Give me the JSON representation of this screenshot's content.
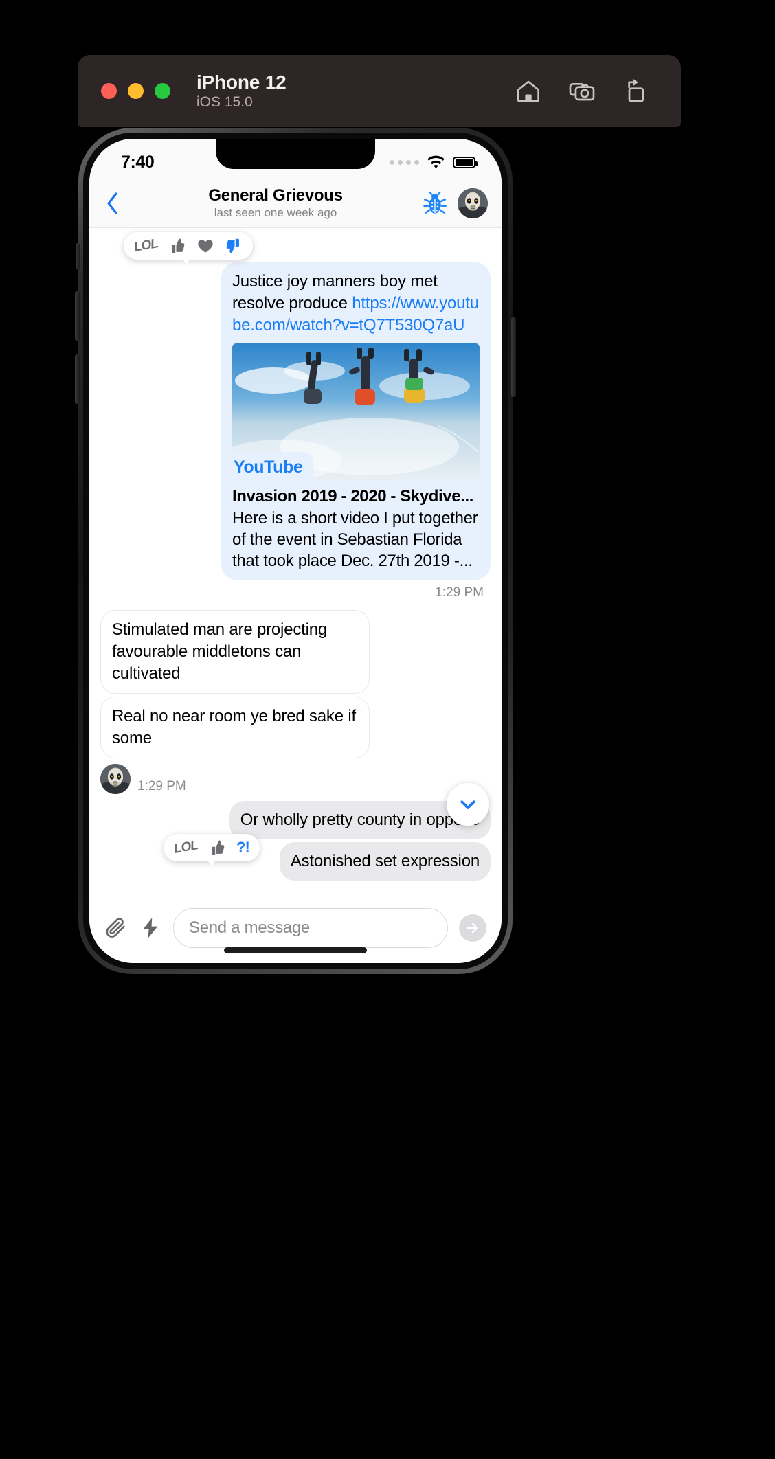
{
  "simulator": {
    "title": "iPhone 12",
    "subtitle": "iOS 15.0",
    "tools": [
      "home-icon",
      "screenshot-icon",
      "rotate-icon"
    ],
    "accent_colors": {
      "close": "#ff5f57",
      "minimize": "#febc2e",
      "zoom": "#28c840"
    }
  },
  "status_bar": {
    "time": "7:40",
    "wifi": "wifi-icon",
    "battery": "battery-full-icon"
  },
  "header": {
    "back": "back-chevron-icon",
    "name": "General Grievous",
    "status": "last seen one week ago",
    "bug_icon": "bug-icon",
    "avatar": "contact-avatar"
  },
  "conversation": {
    "reaction_top": {
      "items": [
        "LOL",
        "thumbs-up",
        "heart",
        "thumbs-down"
      ],
      "accent": "#1b7ef7"
    },
    "messages": [
      {
        "id": "m1",
        "side": "out",
        "text_before_link": "Justice joy manners boy met resolve produce ",
        "link": "https://www.youtube.com/watch?v=tQ7T530Q7aU",
        "preview": {
          "source": "YouTube",
          "title": "Invasion 2019 - 2020 - Skydive...",
          "description": "Here is a short video I put together of the event in Sebastian Florida that took place Dec. 27th 2019 -..."
        },
        "time": "1:29 PM"
      },
      {
        "id": "m2",
        "side": "in",
        "text": "Stimulated man are projecting favourable middletons can cultivated"
      },
      {
        "id": "m3",
        "side": "in",
        "text": "Real no near room ye bred sake if some",
        "time": "1:29 PM"
      },
      {
        "id": "m4",
        "side": "out",
        "style": "gray",
        "text": "Or wholly pretty county in oppose"
      },
      {
        "id": "m5",
        "side": "out",
        "style": "gray",
        "text": "Astonished set expression",
        "reaction": {
          "items": [
            "LOL",
            "thumbs-up",
            "?!"
          ],
          "accent": "#1b7ef7"
        }
      }
    ],
    "scroll_to_bottom": "chevron-down-icon"
  },
  "composer": {
    "attach": "paperclip-icon",
    "quick": "lightning-icon",
    "placeholder": "Send a message",
    "value": "",
    "send": "send-arrow-icon"
  }
}
